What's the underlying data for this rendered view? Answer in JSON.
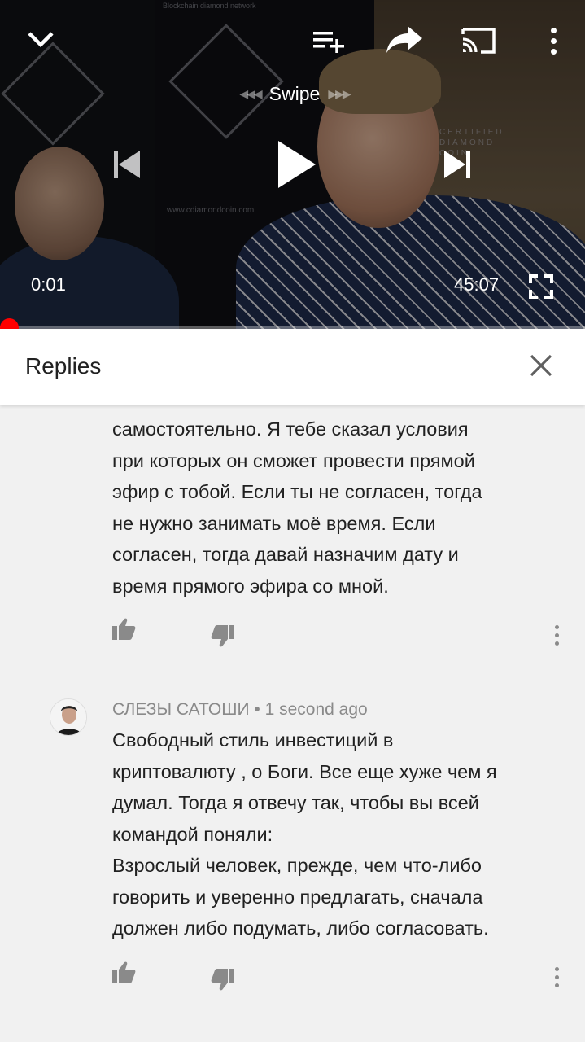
{
  "player": {
    "swipe_label": "Swipe",
    "current_time": "0:01",
    "duration": "45:07",
    "progress_fraction": 0.0,
    "accent_color": "#ff0000",
    "banner_url": "www.cdiamondcoin.com",
    "banner_top": "Blockchain diamond network",
    "banner_brand": "CERTIFIED DIAMOND COIN",
    "icons": {
      "collapse": "chevron-down-icon",
      "add_to_playlist": "playlist-add-icon",
      "share": "share-icon",
      "cast": "cast-icon",
      "more": "more-vert-icon",
      "previous": "skip-previous-icon",
      "play": "play-icon",
      "next": "skip-next-icon",
      "fullscreen": "fullscreen-icon"
    }
  },
  "replies_panel": {
    "title": "Replies",
    "close_icon": "close-icon"
  },
  "comments": [
    {
      "text": "самостоятельно. Я тебе сказал условия\nпри которых он сможет провести прямой\nэфир с тобой. Если ты не согласен, тогда\nне нужно занимать моё время. Если\nсогласен, тогда давай назначим дату и\nвремя прямого эфира со мной."
    },
    {
      "author": "СЛЕЗЫ САТОШИ",
      "separator": " • ",
      "time": "1 second ago",
      "text": "Свободный стиль инвестиций в\nкриптовалюту , о Боги. Все еще хуже чем я\nдумал. Тогда я отвечу так, чтобы вы всей\nкомандой поняли:\nВзрослый человек, прежде, чем что-либо\nговорить и уверенно предлагать, сначала\nдолжен либо подумать, либо согласовать."
    }
  ]
}
